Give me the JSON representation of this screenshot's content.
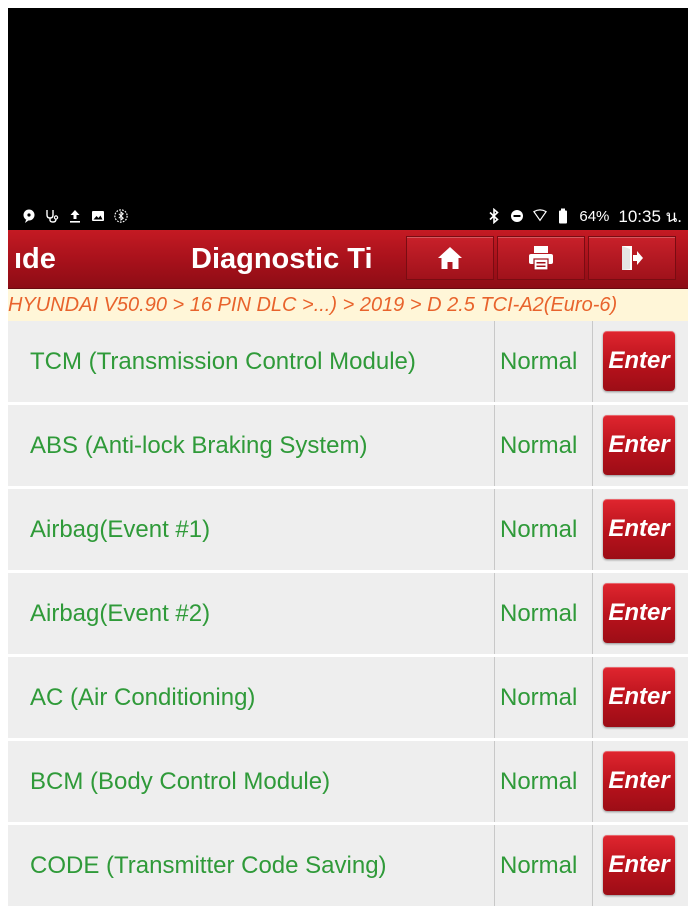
{
  "status_bar": {
    "battery_percent": "64%",
    "time": "10:35 น."
  },
  "title_bar": {
    "left_text": "ıde",
    "title": "Diagnostic Ti",
    "buttons": [
      {
        "name": "home",
        "icon": "home-icon"
      },
      {
        "name": "print",
        "icon": "printer-icon"
      },
      {
        "name": "exit",
        "icon": "exit-icon"
      }
    ]
  },
  "breadcrumb": "HYUNDAI V50.90 > 16 PIN DLC >...) > 2019 > D 2.5 TCI-A2(Euro-6)",
  "modules": [
    {
      "name": "TCM (Transmission Control Module)",
      "status": "Normal",
      "action": "Enter"
    },
    {
      "name": "ABS (Anti-lock Braking System)",
      "status": "Normal",
      "action": "Enter"
    },
    {
      "name": "Airbag(Event #1)",
      "status": "Normal",
      "action": "Enter"
    },
    {
      "name": "Airbag(Event #2)",
      "status": "Normal",
      "action": "Enter"
    },
    {
      "name": "AC (Air Conditioning)",
      "status": "Normal",
      "action": "Enter"
    },
    {
      "name": "BCM (Body Control Module)",
      "status": "Normal",
      "action": "Enter"
    },
    {
      "name": "CODE (Transmitter Code Saving)",
      "status": "Normal",
      "action": "Enter"
    }
  ],
  "colors": {
    "accent_red": "#b8121c",
    "status_green": "#2f9a39",
    "breadcrumb_orange": "#e8632c",
    "breadcrumb_bg": "#fff6d8"
  }
}
